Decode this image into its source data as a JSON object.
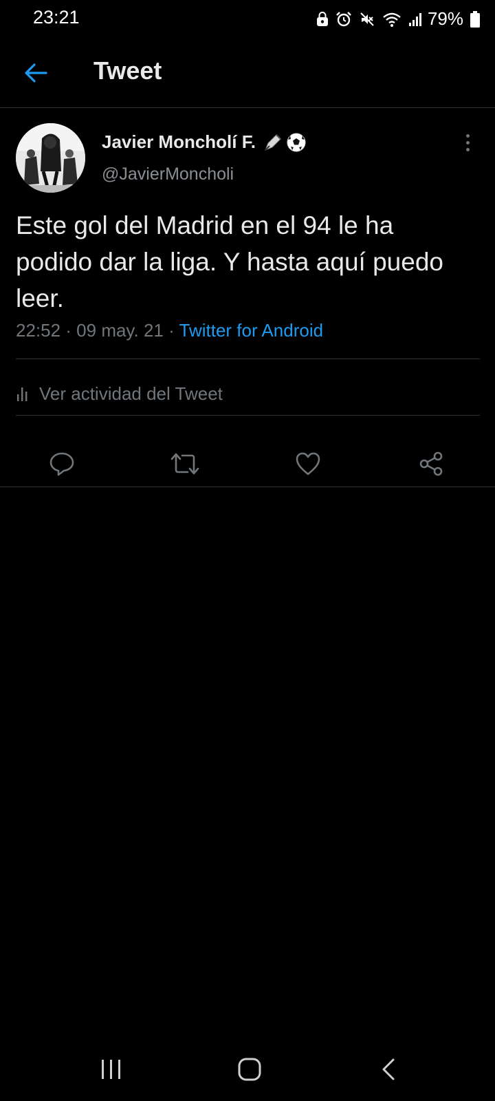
{
  "status_bar": {
    "time": "23:21",
    "battery": "79%",
    "icons": [
      "lock-icon",
      "alarm-icon",
      "mute-icon",
      "wifi-icon",
      "signal-icon",
      "battery-icon"
    ]
  },
  "header": {
    "title": "Tweet",
    "back_icon": "back-arrow-icon"
  },
  "tweet": {
    "author": {
      "display_name": "Javier Moncholí F.",
      "name_emojis": [
        "pen-nib-icon",
        "soccer-ball-icon"
      ],
      "handle": "@JavierMoncholi"
    },
    "text": "Este gol del Madrid en el 94 le ha podido dar la liga. Y hasta aquí puedo leer.",
    "timestamp": "22:52 · 09 may. 21 · ",
    "source": "Twitter for Android",
    "activity_label": "Ver actividad del Tweet",
    "actions": [
      "reply-icon",
      "retweet-icon",
      "like-icon",
      "share-icon"
    ]
  },
  "nav_bar": {
    "buttons": [
      "recent-apps-icon",
      "home-icon",
      "back-icon"
    ]
  },
  "colors": {
    "background": "#000000",
    "accent": "#1d9bf0",
    "secondary_text": "#71767b",
    "divider": "#2f3336"
  }
}
